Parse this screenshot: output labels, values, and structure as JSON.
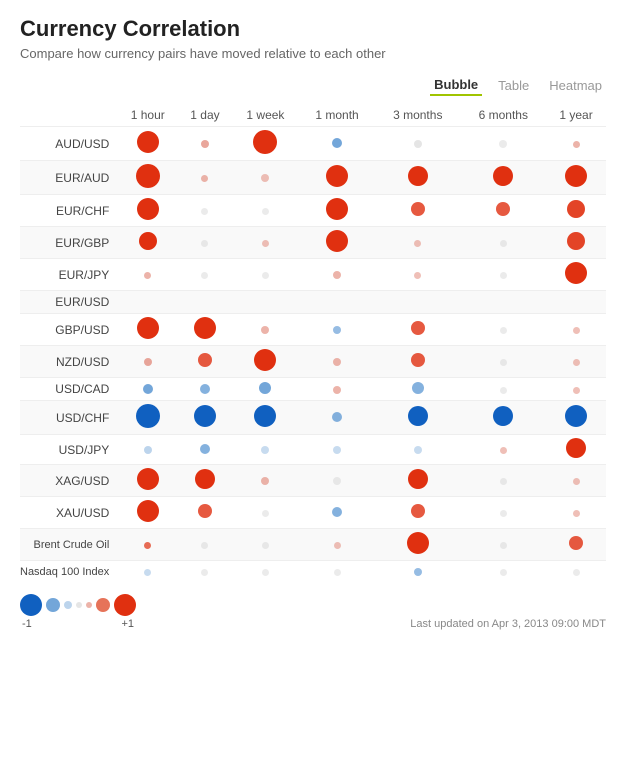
{
  "title": "Currency Correlation",
  "subtitle": "Compare how currency pairs have moved relative to each other",
  "tabs": [
    {
      "label": "Bubble",
      "active": true
    },
    {
      "label": "Table",
      "active": false
    },
    {
      "label": "Heatmap",
      "active": false
    }
  ],
  "columns": [
    "1 hour",
    "1 day",
    "1 week",
    "1 month",
    "3 months",
    "6 months",
    "1 year"
  ],
  "rows": [
    {
      "label": "AUD/USD",
      "highlighted": false,
      "eur_usd_spacer": false,
      "bubbles": [
        {
          "size": 22,
          "color": "#e03010",
          "opacity": 1
        },
        {
          "size": 8,
          "color": "#e08070",
          "opacity": 0.7
        },
        {
          "size": 24,
          "color": "#e03010",
          "opacity": 1
        },
        {
          "size": 10,
          "color": "#5090d0",
          "opacity": 0.8
        },
        {
          "size": 8,
          "color": "#ccc",
          "opacity": 0.5
        },
        {
          "size": 8,
          "color": "#ccc",
          "opacity": 0.4
        },
        {
          "size": 7,
          "color": "#e08070",
          "opacity": 0.6
        }
      ]
    },
    {
      "label": "EUR/AUD",
      "highlighted": false,
      "eur_usd_spacer": false,
      "bubbles": [
        {
          "size": 24,
          "color": "#e03010",
          "opacity": 1
        },
        {
          "size": 7,
          "color": "#e08070",
          "opacity": 0.6
        },
        {
          "size": 8,
          "color": "#e08070",
          "opacity": 0.5
        },
        {
          "size": 22,
          "color": "#e03010",
          "opacity": 1
        },
        {
          "size": 20,
          "color": "#e03010",
          "opacity": 1
        },
        {
          "size": 20,
          "color": "#e03010",
          "opacity": 1
        },
        {
          "size": 22,
          "color": "#e03010",
          "opacity": 1
        }
      ]
    },
    {
      "label": "EUR/CHF",
      "highlighted": false,
      "eur_usd_spacer": false,
      "bubbles": [
        {
          "size": 22,
          "color": "#e03010",
          "opacity": 1
        },
        {
          "size": 7,
          "color": "#ccc",
          "opacity": 0.4
        },
        {
          "size": 7,
          "color": "#ccc",
          "opacity": 0.4
        },
        {
          "size": 22,
          "color": "#e03010",
          "opacity": 1
        },
        {
          "size": 14,
          "color": "#e03010",
          "opacity": 0.8
        },
        {
          "size": 14,
          "color": "#e03010",
          "opacity": 0.8
        },
        {
          "size": 18,
          "color": "#e03010",
          "opacity": 0.9
        }
      ]
    },
    {
      "label": "EUR/GBP",
      "highlighted": false,
      "eur_usd_spacer": false,
      "bubbles": [
        {
          "size": 18,
          "color": "#e03010",
          "opacity": 1
        },
        {
          "size": 7,
          "color": "#ccc",
          "opacity": 0.4
        },
        {
          "size": 7,
          "color": "#e08070",
          "opacity": 0.5
        },
        {
          "size": 22,
          "color": "#e03010",
          "opacity": 1
        },
        {
          "size": 7,
          "color": "#e08070",
          "opacity": 0.5
        },
        {
          "size": 7,
          "color": "#ccc",
          "opacity": 0.4
        },
        {
          "size": 18,
          "color": "#e03010",
          "opacity": 0.9
        }
      ]
    },
    {
      "label": "EUR/JPY",
      "highlighted": false,
      "eur_usd_spacer": false,
      "bubbles": [
        {
          "size": 7,
          "color": "#e08070",
          "opacity": 0.6
        },
        {
          "size": 7,
          "color": "#ccc",
          "opacity": 0.4
        },
        {
          "size": 7,
          "color": "#ccc",
          "opacity": 0.4
        },
        {
          "size": 8,
          "color": "#e08070",
          "opacity": 0.6
        },
        {
          "size": 7,
          "color": "#e08070",
          "opacity": 0.5
        },
        {
          "size": 7,
          "color": "#ccc",
          "opacity": 0.4
        },
        {
          "size": 22,
          "color": "#e03010",
          "opacity": 1
        }
      ]
    },
    {
      "label": "EUR/USD",
      "highlighted": true,
      "eur_usd_spacer": true,
      "bubbles": []
    },
    {
      "label": "GBP/USD",
      "highlighted": false,
      "eur_usd_spacer": false,
      "bubbles": [
        {
          "size": 22,
          "color": "#e03010",
          "opacity": 1
        },
        {
          "size": 22,
          "color": "#e03010",
          "opacity": 1
        },
        {
          "size": 8,
          "color": "#e08070",
          "opacity": 0.6
        },
        {
          "size": 8,
          "color": "#5090d0",
          "opacity": 0.6
        },
        {
          "size": 14,
          "color": "#e03010",
          "opacity": 0.8
        },
        {
          "size": 7,
          "color": "#ccc",
          "opacity": 0.4
        },
        {
          "size": 7,
          "color": "#e08070",
          "opacity": 0.5
        }
      ]
    },
    {
      "label": "NZD/USD",
      "highlighted": false,
      "eur_usd_spacer": false,
      "bubbles": [
        {
          "size": 8,
          "color": "#e08070",
          "opacity": 0.7
        },
        {
          "size": 14,
          "color": "#e03010",
          "opacity": 0.8
        },
        {
          "size": 22,
          "color": "#e03010",
          "opacity": 1
        },
        {
          "size": 8,
          "color": "#e08070",
          "opacity": 0.6
        },
        {
          "size": 14,
          "color": "#e03010",
          "opacity": 0.8
        },
        {
          "size": 7,
          "color": "#ccc",
          "opacity": 0.4
        },
        {
          "size": 7,
          "color": "#e08070",
          "opacity": 0.5
        }
      ]
    },
    {
      "label": "USD/CAD",
      "highlighted": false,
      "eur_usd_spacer": false,
      "bubbles": [
        {
          "size": 10,
          "color": "#5090d0",
          "opacity": 0.8
        },
        {
          "size": 10,
          "color": "#5090d0",
          "opacity": 0.7
        },
        {
          "size": 12,
          "color": "#5090d0",
          "opacity": 0.8
        },
        {
          "size": 8,
          "color": "#e08070",
          "opacity": 0.6
        },
        {
          "size": 12,
          "color": "#5090d0",
          "opacity": 0.7
        },
        {
          "size": 7,
          "color": "#ccc",
          "opacity": 0.4
        },
        {
          "size": 7,
          "color": "#e08070",
          "opacity": 0.5
        }
      ]
    },
    {
      "label": "USD/CHF",
      "highlighted": false,
      "eur_usd_spacer": false,
      "bubbles": [
        {
          "size": 24,
          "color": "#1060c0",
          "opacity": 1
        },
        {
          "size": 22,
          "color": "#1060c0",
          "opacity": 1
        },
        {
          "size": 22,
          "color": "#1060c0",
          "opacity": 1
        },
        {
          "size": 10,
          "color": "#5090d0",
          "opacity": 0.7
        },
        {
          "size": 20,
          "color": "#1060c0",
          "opacity": 1
        },
        {
          "size": 20,
          "color": "#1060c0",
          "opacity": 1
        },
        {
          "size": 22,
          "color": "#1060c0",
          "opacity": 1
        }
      ]
    },
    {
      "label": "USD/JPY",
      "highlighted": false,
      "eur_usd_spacer": false,
      "bubbles": [
        {
          "size": 8,
          "color": "#90b8e0",
          "opacity": 0.6
        },
        {
          "size": 10,
          "color": "#5090d0",
          "opacity": 0.7
        },
        {
          "size": 8,
          "color": "#90b8e0",
          "opacity": 0.5
        },
        {
          "size": 8,
          "color": "#90b8e0",
          "opacity": 0.5
        },
        {
          "size": 8,
          "color": "#90b8e0",
          "opacity": 0.5
        },
        {
          "size": 7,
          "color": "#e08070",
          "opacity": 0.5
        },
        {
          "size": 20,
          "color": "#e03010",
          "opacity": 1
        }
      ]
    },
    {
      "label": "XAG/USD",
      "highlighted": false,
      "eur_usd_spacer": false,
      "bubbles": [
        {
          "size": 22,
          "color": "#e03010",
          "opacity": 1
        },
        {
          "size": 20,
          "color": "#e03010",
          "opacity": 1
        },
        {
          "size": 8,
          "color": "#e08070",
          "opacity": 0.6
        },
        {
          "size": 8,
          "color": "#ccc",
          "opacity": 0.4
        },
        {
          "size": 20,
          "color": "#e03010",
          "opacity": 1
        },
        {
          "size": 7,
          "color": "#ccc",
          "opacity": 0.4
        },
        {
          "size": 7,
          "color": "#e08070",
          "opacity": 0.5
        }
      ]
    },
    {
      "label": "XAU/USD",
      "highlighted": false,
      "eur_usd_spacer": false,
      "bubbles": [
        {
          "size": 22,
          "color": "#e03010",
          "opacity": 1
        },
        {
          "size": 14,
          "color": "#e03010",
          "opacity": 0.8
        },
        {
          "size": 7,
          "color": "#ccc",
          "opacity": 0.4
        },
        {
          "size": 10,
          "color": "#5090d0",
          "opacity": 0.7
        },
        {
          "size": 14,
          "color": "#e03010",
          "opacity": 0.8
        },
        {
          "size": 7,
          "color": "#ccc",
          "opacity": 0.4
        },
        {
          "size": 7,
          "color": "#e08070",
          "opacity": 0.5
        }
      ]
    },
    {
      "label": "Brent Crude Oil",
      "highlighted": false,
      "eur_usd_spacer": false,
      "bubbles": [
        {
          "size": 7,
          "color": "#e03010",
          "opacity": 0.7
        },
        {
          "size": 7,
          "color": "#ccc",
          "opacity": 0.4
        },
        {
          "size": 7,
          "color": "#ccc",
          "opacity": 0.4
        },
        {
          "size": 7,
          "color": "#e08070",
          "opacity": 0.5
        },
        {
          "size": 22,
          "color": "#e03010",
          "opacity": 1
        },
        {
          "size": 7,
          "color": "#ccc",
          "opacity": 0.4
        },
        {
          "size": 14,
          "color": "#e03010",
          "opacity": 0.8
        }
      ]
    },
    {
      "label": "Nasdaq 100 Index",
      "highlighted": false,
      "eur_usd_spacer": false,
      "bubbles": [
        {
          "size": 7,
          "color": "#90b8e0",
          "opacity": 0.5
        },
        {
          "size": 7,
          "color": "#ccc",
          "opacity": 0.4
        },
        {
          "size": 7,
          "color": "#ccc",
          "opacity": 0.4
        },
        {
          "size": 7,
          "color": "#ccc",
          "opacity": 0.4
        },
        {
          "size": 8,
          "color": "#5090d0",
          "opacity": 0.6
        },
        {
          "size": 7,
          "color": "#ccc",
          "opacity": 0.4
        },
        {
          "size": 7,
          "color": "#ccc",
          "opacity": 0.4
        }
      ]
    }
  ],
  "legend": {
    "neg_label": "-1",
    "pos_label": "+1",
    "bubbles": [
      {
        "size": 22,
        "color": "#1060c0",
        "opacity": 1
      },
      {
        "size": 14,
        "color": "#5090d0",
        "opacity": 0.8
      },
      {
        "size": 8,
        "color": "#90b8e0",
        "opacity": 0.6
      },
      {
        "size": 6,
        "color": "#ccc",
        "opacity": 0.5
      },
      {
        "size": 6,
        "color": "#e08070",
        "opacity": 0.6
      },
      {
        "size": 14,
        "color": "#e05030",
        "opacity": 0.8
      },
      {
        "size": 22,
        "color": "#e03010",
        "opacity": 1
      }
    ]
  },
  "last_updated": "Last updated on Apr 3, 2013 09:00 MDT"
}
